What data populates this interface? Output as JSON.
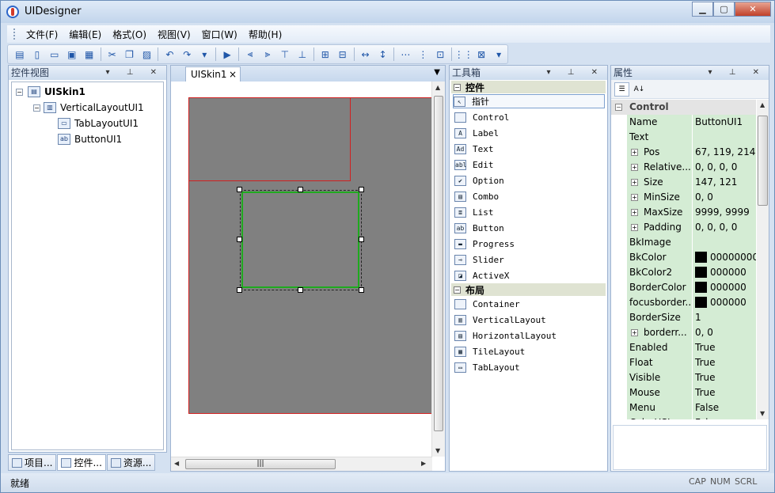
{
  "window": {
    "title": "UIDesigner",
    "min": "0",
    "max": "1",
    "close": "r"
  },
  "menu": [
    "文件(F)",
    "编辑(E)",
    "格式(O)",
    "视图(V)",
    "窗口(W)",
    "帮助(H)"
  ],
  "toolbar": [
    {
      "icon": "new-icon",
      "glyph": "▤"
    },
    {
      "icon": "new-file-icon",
      "glyph": "▯"
    },
    {
      "icon": "open-folder-icon",
      "glyph": "▭"
    },
    {
      "icon": "save-icon",
      "glyph": "▣"
    },
    {
      "icon": "save-all-icon",
      "glyph": "▦"
    },
    "sep",
    {
      "icon": "cut-icon",
      "glyph": "✂"
    },
    {
      "icon": "copy-icon",
      "glyph": "❐"
    },
    {
      "icon": "paste-icon",
      "glyph": "▨"
    },
    "sep",
    {
      "icon": "undo-icon",
      "glyph": "↶"
    },
    {
      "icon": "redo-icon",
      "glyph": "↷"
    },
    {
      "icon": "more-icon",
      "glyph": "▾"
    },
    "sep",
    {
      "icon": "run-preview-icon",
      "glyph": "▶"
    },
    "sep",
    {
      "icon": "align-left-icon",
      "glyph": "⫷"
    },
    {
      "icon": "align-right-icon",
      "glyph": "⫸"
    },
    {
      "icon": "align-top-icon",
      "glyph": "⊤"
    },
    {
      "icon": "align-bottom-icon",
      "glyph": "⊥"
    },
    "sep",
    {
      "icon": "center-vertical-icon",
      "glyph": "⊞"
    },
    {
      "icon": "center-horizontal-icon",
      "glyph": "⊟"
    },
    "sep",
    {
      "icon": "same-width-icon",
      "glyph": "↔"
    },
    {
      "icon": "same-height-icon",
      "glyph": "↕"
    },
    "sep",
    {
      "icon": "space-horizontal-icon",
      "glyph": "⋯"
    },
    {
      "icon": "space-vertical-icon",
      "glyph": "⋮"
    },
    {
      "icon": "same-size-icon",
      "glyph": "⊡"
    },
    "sep",
    {
      "icon": "grid-icon",
      "glyph": "⋮⋮"
    },
    {
      "icon": "select-frame-icon",
      "glyph": "⊠"
    },
    {
      "icon": "more-icon",
      "glyph": "▾"
    }
  ],
  "control_view": {
    "title": "控件视图",
    "tree": [
      {
        "label": "UISkin1",
        "icon": "window-icon"
      },
      {
        "label": "VerticalLayoutUI1",
        "icon": "vertical-layout-icon"
      },
      {
        "label": "TabLayoutUI1",
        "icon": "tab-layout-icon"
      },
      {
        "label": "ButtonUI1",
        "icon": "button-icon",
        "icon_text": "ab"
      }
    ],
    "tabs": [
      "项目...",
      "控件...",
      "资源..."
    ]
  },
  "document": {
    "tab": "UISkin1",
    "close": "×"
  },
  "toolbox": {
    "title": "工具箱",
    "controls_section": "控件",
    "controls": [
      {
        "label": "指针",
        "icon": "pointer-icon",
        "g": "↖"
      },
      {
        "label": "Control",
        "icon": "control-icon",
        "g": ""
      },
      {
        "label": "Label",
        "icon": "label-icon",
        "g": "A"
      },
      {
        "label": "Text",
        "icon": "text-icon",
        "g": "Ad"
      },
      {
        "label": "Edit",
        "icon": "edit-icon",
        "g": "abl"
      },
      {
        "label": "Option",
        "icon": "option-icon",
        "g": "✔"
      },
      {
        "label": "Combo",
        "icon": "combo-icon",
        "g": "▤"
      },
      {
        "label": "List",
        "icon": "list-icon",
        "g": "≣"
      },
      {
        "label": "Button",
        "icon": "button-icon",
        "g": "ab"
      },
      {
        "label": "Progress",
        "icon": "progress-icon",
        "g": "▬"
      },
      {
        "label": "Slider",
        "icon": "slider-icon",
        "g": "⊸"
      },
      {
        "label": "ActiveX",
        "icon": "activex-icon",
        "g": "◪"
      }
    ],
    "layout_section": "布局",
    "layouts": [
      {
        "label": "Container",
        "icon": "container-icon",
        "g": ""
      },
      {
        "label": "VerticalLayout",
        "icon": "vertical-layout-icon",
        "g": "▥"
      },
      {
        "label": "HorizontalLayout",
        "icon": "horizontal-layout-icon",
        "g": "▤"
      },
      {
        "label": "TileLayout",
        "icon": "tile-layout-icon",
        "g": "▦"
      },
      {
        "label": "TabLayout",
        "icon": "tab-layout-icon",
        "g": "▭"
      }
    ]
  },
  "properties": {
    "title": "属性",
    "category": "Control",
    "rows": [
      {
        "name": "Name",
        "value": "ButtonUI1"
      },
      {
        "name": "Text",
        "value": ""
      },
      {
        "name": "Pos",
        "value": "67, 119, 214,...",
        "expand": true
      },
      {
        "name": "Relative...",
        "value": "0, 0, 0, 0",
        "expand": true
      },
      {
        "name": "Size",
        "value": "147, 121",
        "expand": true
      },
      {
        "name": "MinSize",
        "value": "0, 0",
        "expand": true
      },
      {
        "name": "MaxSize",
        "value": "9999, 9999",
        "expand": true
      },
      {
        "name": "Padding",
        "value": "0, 0, 0, 0",
        "expand": true
      },
      {
        "name": "BkImage",
        "value": ""
      },
      {
        "name": "BkColor",
        "value": "00000000",
        "color": true
      },
      {
        "name": "BkColor2",
        "value": "000000",
        "color": true
      },
      {
        "name": "BorderColor",
        "value": "000000",
        "color": true
      },
      {
        "name": "focusborder...",
        "value": "000000",
        "color": true
      },
      {
        "name": "BorderSize",
        "value": "1"
      },
      {
        "name": "borderr...",
        "value": "0, 0",
        "expand": true
      },
      {
        "name": "Enabled",
        "value": "True"
      },
      {
        "name": "Float",
        "value": "True"
      },
      {
        "name": "Visible",
        "value": "True"
      },
      {
        "name": "Mouse",
        "value": "True"
      },
      {
        "name": "Menu",
        "value": "False"
      },
      {
        "name": "ColorHSL",
        "value": "False"
      }
    ]
  },
  "status": {
    "message": "就绪",
    "caps": "CAP",
    "num": "NUM",
    "scrl": "SCRL"
  }
}
